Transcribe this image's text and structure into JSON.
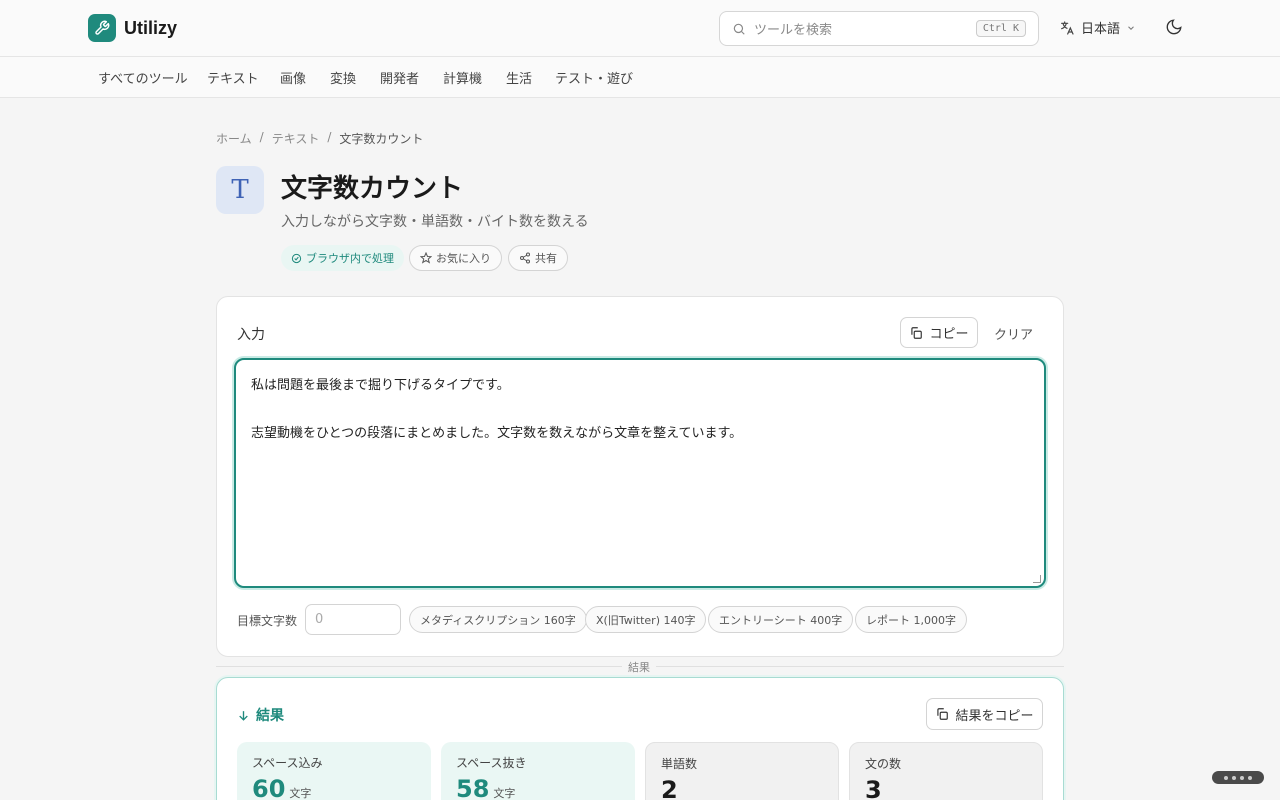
{
  "app": {
    "name": "Utilizy"
  },
  "search": {
    "placeholder": "ツールを検索",
    "shortcut": "Ctrl K"
  },
  "language": {
    "label": "日本語"
  },
  "nav": {
    "items": [
      "すべてのツール",
      "テキスト",
      "画像",
      "変換",
      "開発者",
      "計算機",
      "生活",
      "テスト・遊び"
    ]
  },
  "breadcrumb": {
    "items": [
      "ホーム",
      "テキスト",
      "文字数カウント"
    ],
    "separator": "/"
  },
  "tool": {
    "icon_glyph": "T",
    "title": "文字数カウント",
    "subtitle": "入力しながら文字数・単語数・バイト数を数える",
    "badge_browser": "ブラウザ内で処理",
    "favorite_label": "お気に入り",
    "share_label": "共有"
  },
  "input": {
    "label": "入力",
    "copy_label": "コピー",
    "clear_label": "クリア",
    "text": "私は問題を最後まで掘り下げるタイプです。\n\n志望動機をひとつの段落にまとめました。文字数を数えながら文章を整えています。",
    "goal_label": "目標文字数",
    "goal_placeholder": "0",
    "presets": [
      "メタディスクリプション 160字",
      "X(旧Twitter) 140字",
      "エントリーシート 400字",
      "レポート 1,000字"
    ]
  },
  "divider": {
    "label": "結果"
  },
  "results": {
    "title": "結果",
    "copy_label": "結果をコピー",
    "stats": [
      {
        "label": "スペース込み",
        "value": "60",
        "unit": "文字"
      },
      {
        "label": "スペース抜き",
        "value": "58",
        "unit": "文字"
      },
      {
        "label": "単語数",
        "value": "2",
        "unit": ""
      },
      {
        "label": "文の数",
        "value": "3",
        "unit": ""
      }
    ]
  },
  "colors": {
    "accent": "#1f8a7d",
    "icon_bg": "#dfe7f5"
  }
}
